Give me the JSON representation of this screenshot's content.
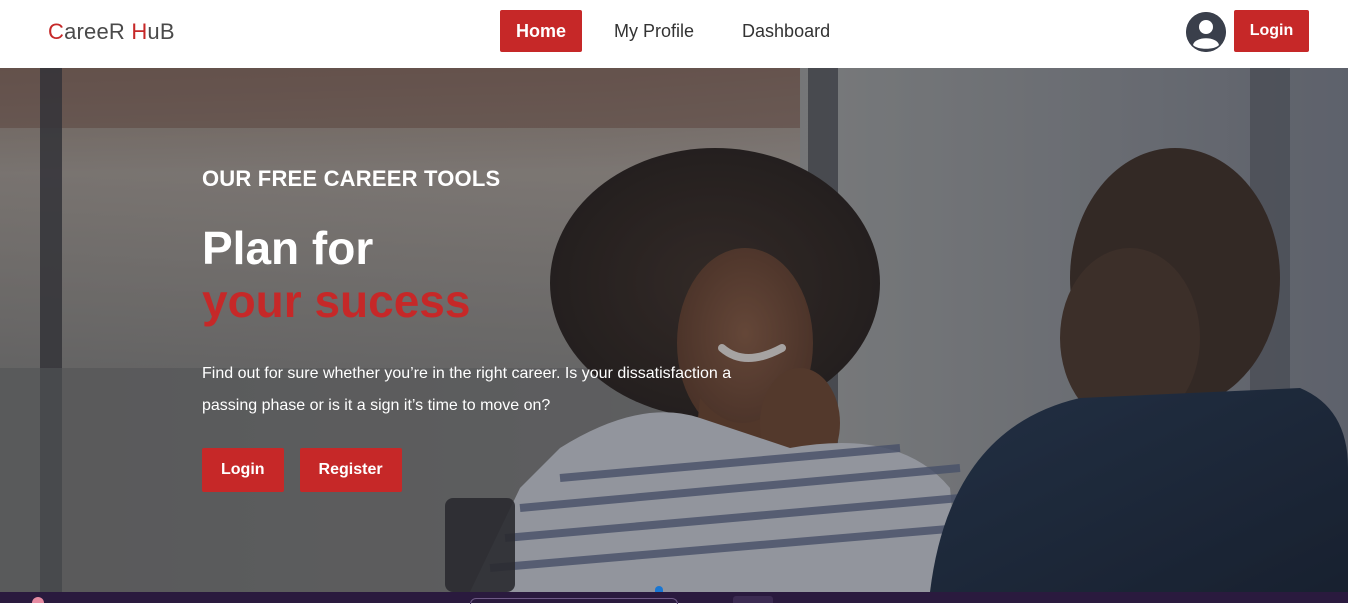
{
  "navbar": {
    "brand_first_letter": "C",
    "brand_mid": "areeR ",
    "brand_second_letter": "H",
    "brand_end": "uB",
    "links": [
      {
        "label": "Home",
        "active": true
      },
      {
        "label": "My Profile",
        "active": false
      },
      {
        "label": "Dashboard",
        "active": false
      }
    ],
    "user_icon": "user-circle-icon",
    "login_label": "Login"
  },
  "hero": {
    "eyebrow": "OUR FREE CAREER TOOLS",
    "headline_line1": "Plan for",
    "headline_line2": "your sucess",
    "lead": "Find out for sure whether you’re in the right career. Is your dissatisfaction a passing phase or is it a sign it’s time to move on?",
    "buttons": {
      "login": "Login",
      "register": "Register"
    }
  },
  "colors": {
    "accent": "#c62828",
    "nav_text": "#333333",
    "brand_text": "#4a4a4a",
    "carousel_indicator": "#1976d2"
  }
}
